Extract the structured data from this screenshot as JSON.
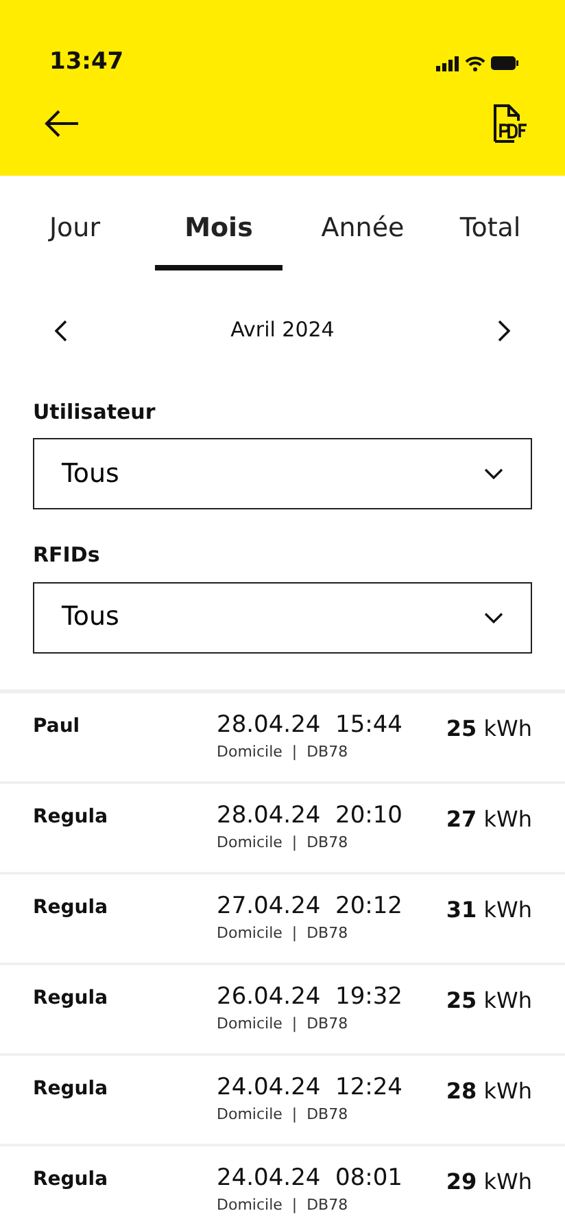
{
  "status_bar": {
    "time": "13:47"
  },
  "tabs": [
    {
      "label": "Jour",
      "selected": false
    },
    {
      "label": "Mois",
      "selected": true
    },
    {
      "label": "Année",
      "selected": false
    },
    {
      "label": "Total",
      "selected": false
    }
  ],
  "period": {
    "label": "Avril 2024"
  },
  "filters": [
    {
      "label": "Utilisateur",
      "value": "Tous"
    },
    {
      "label": "RFIDs",
      "value": "Tous"
    }
  ],
  "sessions": [
    {
      "user": "Paul",
      "date": "28.04.24",
      "time": "15:44",
      "place": "Domicile  |  DB78",
      "energy": "**25** kWh"
    },
    {
      "user": "Regula",
      "date": "28.04.24",
      "time": "20:10",
      "place": "Domicile  |  DB78",
      "energy": "**27** kWh"
    },
    {
      "user": "Regula",
      "date": "27.04.24",
      "time": "20:12",
      "place": "Domicile  |  DB78",
      "energy": "**31** kWh"
    },
    {
      "user": "Regula",
      "date": "26.04.24",
      "time": "19:32",
      "place": "Domicile  |  DB78",
      "energy": "**25** kWh"
    },
    {
      "user": "Regula",
      "date": "24.04.24",
      "time": "12:24",
      "place": "Domicile  |  DB78",
      "energy": "**28** kWh"
    },
    {
      "user": "Regula",
      "date": "24.04.24",
      "time": "08:01",
      "place": "Domicile  |  DB78",
      "energy": "**29** kWh"
    }
  ]
}
